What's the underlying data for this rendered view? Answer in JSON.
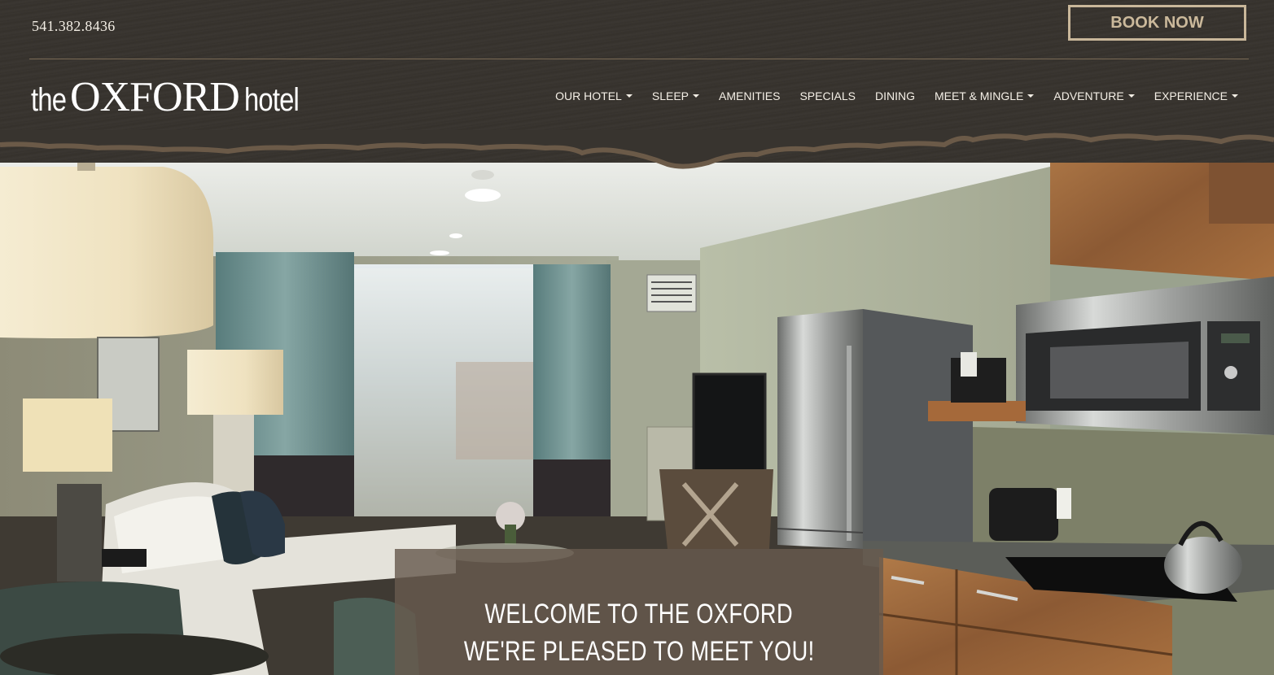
{
  "header": {
    "phone": "541.382.8436",
    "book_button": "BOOK NOW",
    "logo": {
      "the": "the",
      "name": "OXFORD",
      "hotel": "hotel"
    }
  },
  "nav": {
    "items": [
      {
        "label": "OUR HOTEL",
        "dropdown": true
      },
      {
        "label": "SLEEP",
        "dropdown": true
      },
      {
        "label": "AMENITIES",
        "dropdown": false
      },
      {
        "label": "SPECIALS",
        "dropdown": false
      },
      {
        "label": "DINING",
        "dropdown": false
      },
      {
        "label": "MEET & MINGLE",
        "dropdown": true
      },
      {
        "label": "ADVENTURE",
        "dropdown": true
      },
      {
        "label": "EXPERIENCE",
        "dropdown": true
      }
    ]
  },
  "hero": {
    "welcome_line1": "WELCOME TO THE OXFORD",
    "welcome_line2": "WE'RE PLEASED TO MEET YOU!"
  },
  "colors": {
    "header_bg": "#38342f",
    "accent_tan": "#c9b79a",
    "welcome_box": "#685a4e"
  }
}
